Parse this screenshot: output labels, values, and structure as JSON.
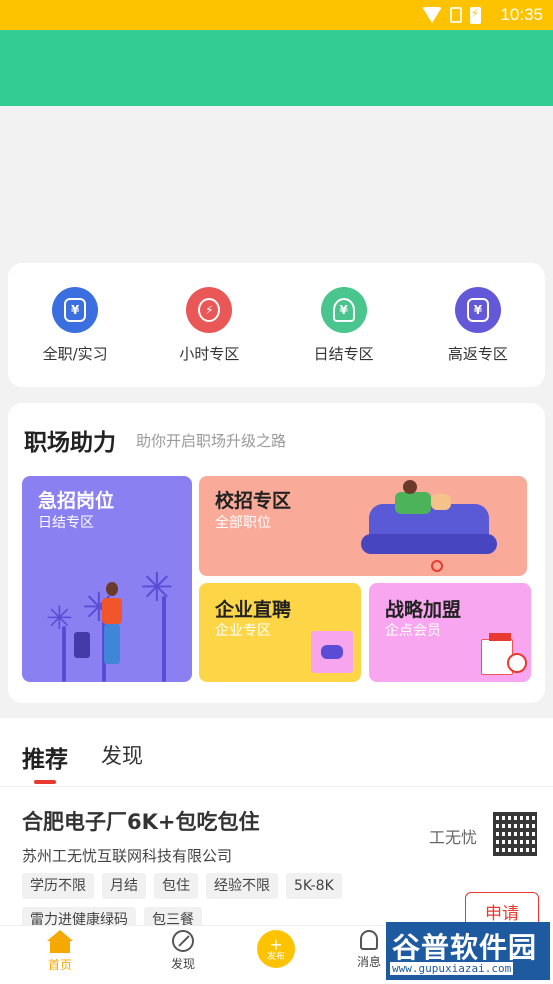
{
  "status_bar": {
    "time": "10:35"
  },
  "categories": [
    {
      "label": "全职/实习",
      "color": "#3b6fdf",
      "glyph": "¥"
    },
    {
      "label": "小时专区",
      "color": "#e95757",
      "glyph": "⚡"
    },
    {
      "label": "日结专区",
      "color": "#49c58d",
      "glyph": "¥"
    },
    {
      "label": "高返专区",
      "color": "#6359d8",
      "glyph": "¥"
    }
  ],
  "assist": {
    "title": "职场助力",
    "subtitle": "助你开启职场升级之路",
    "tiles": {
      "urgent": {
        "title": "急招岗位",
        "sub": "日结专区"
      },
      "campus": {
        "title": "校招专区",
        "sub": "全部职位"
      },
      "direct": {
        "title": "企业直聘",
        "sub": "企业专区"
      },
      "league": {
        "title": "战略加盟",
        "sub": "企点会员"
      }
    }
  },
  "feed": {
    "tabs": [
      "推荐",
      "发现"
    ],
    "job": {
      "title": "合肥电子厂6K+包吃包住",
      "company": "苏州工无忧互联网科技有限公司",
      "tags": [
        "学历不限",
        "月结",
        "包住",
        "经验不限",
        "5K-8K",
        "雷力进健康绿码",
        "包三餐"
      ],
      "poster": "工无忧",
      "apply_label": "申请"
    }
  },
  "navbar": {
    "home": "首页",
    "discover": "发现",
    "publish": "发布",
    "messages": "消息"
  },
  "watermark": {
    "title": "谷普软件园",
    "url": "www.gupuxiazai.com"
  }
}
